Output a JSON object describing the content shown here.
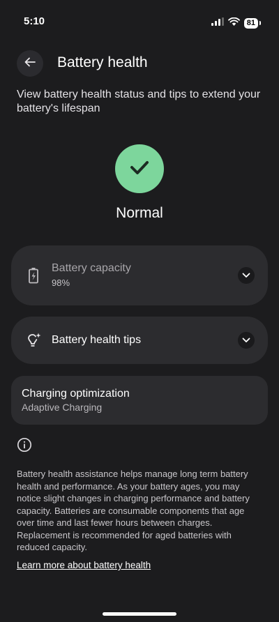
{
  "status_bar": {
    "time": "5:10",
    "battery_level": "81",
    "icons": [
      "signal-icon",
      "wifi-icon",
      "battery-icon"
    ]
  },
  "header": {
    "title": "Battery health",
    "back_icon": "arrow-left-icon"
  },
  "subtitle": "View battery health status and tips to extend your battery's lifespan",
  "health_status": {
    "label": "Normal",
    "icon": "checkmark-icon",
    "color": "#7dd69c"
  },
  "cards": {
    "capacity": {
      "title": "Battery capacity",
      "value": "98%",
      "icon": "battery-charging-icon"
    },
    "tips": {
      "title": "Battery health tips",
      "icon": "lightbulb-sparkle-icon"
    },
    "charging": {
      "title": "Charging optimization",
      "value": "Adaptive Charging"
    }
  },
  "info": {
    "icon": "info-icon",
    "text": "Battery health assistance helps manage long term battery health and performance. As your battery ages, you may notice slight changes in charging performance and battery capacity. Batteries are consumable components that age over time and last fewer hours between charges. Replacement is recommended for aged batteries with reduced capacity.",
    "link": "Learn more about battery health"
  },
  "colors": {
    "background": "#1c1c1e",
    "card": "#2c2c2f",
    "accent_green": "#7dd69c"
  }
}
